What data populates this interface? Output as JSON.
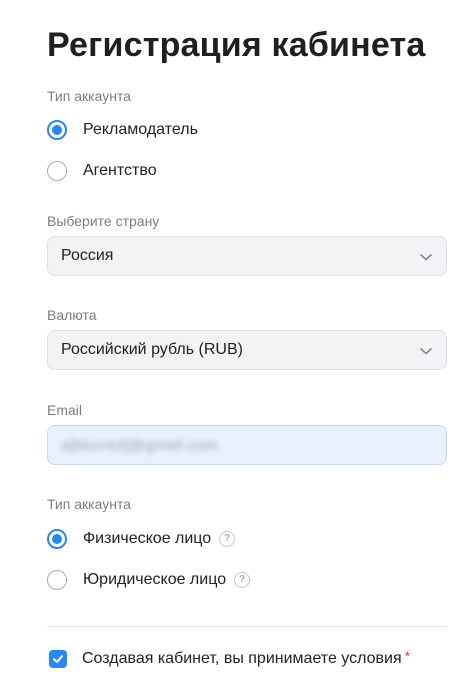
{
  "page": {
    "title": "Регистрация кабинета"
  },
  "account_type": {
    "label": "Тип аккаунта",
    "options": [
      {
        "label": "Рекламодатель",
        "checked": true
      },
      {
        "label": "Агентство",
        "checked": false
      }
    ]
  },
  "country": {
    "label": "Выберите страну",
    "value": "Россия"
  },
  "currency": {
    "label": "Валюта",
    "value": "Российский рубль (RUB)"
  },
  "email": {
    "label": "Email",
    "value": "a[blurred]@gmail.com"
  },
  "legal_type": {
    "label": "Тип аккаунта",
    "options": [
      {
        "label": "Физическое лицо",
        "checked": true,
        "help_icon": "question-icon"
      },
      {
        "label": "Юридическое лицо",
        "checked": false,
        "help_icon": "question-icon"
      }
    ]
  },
  "terms": {
    "label": "Создавая кабинет, вы принимаете условия",
    "required_mark": "*",
    "checked": true
  },
  "colors": {
    "accent": "#2787f5",
    "required": "#e64646"
  }
}
